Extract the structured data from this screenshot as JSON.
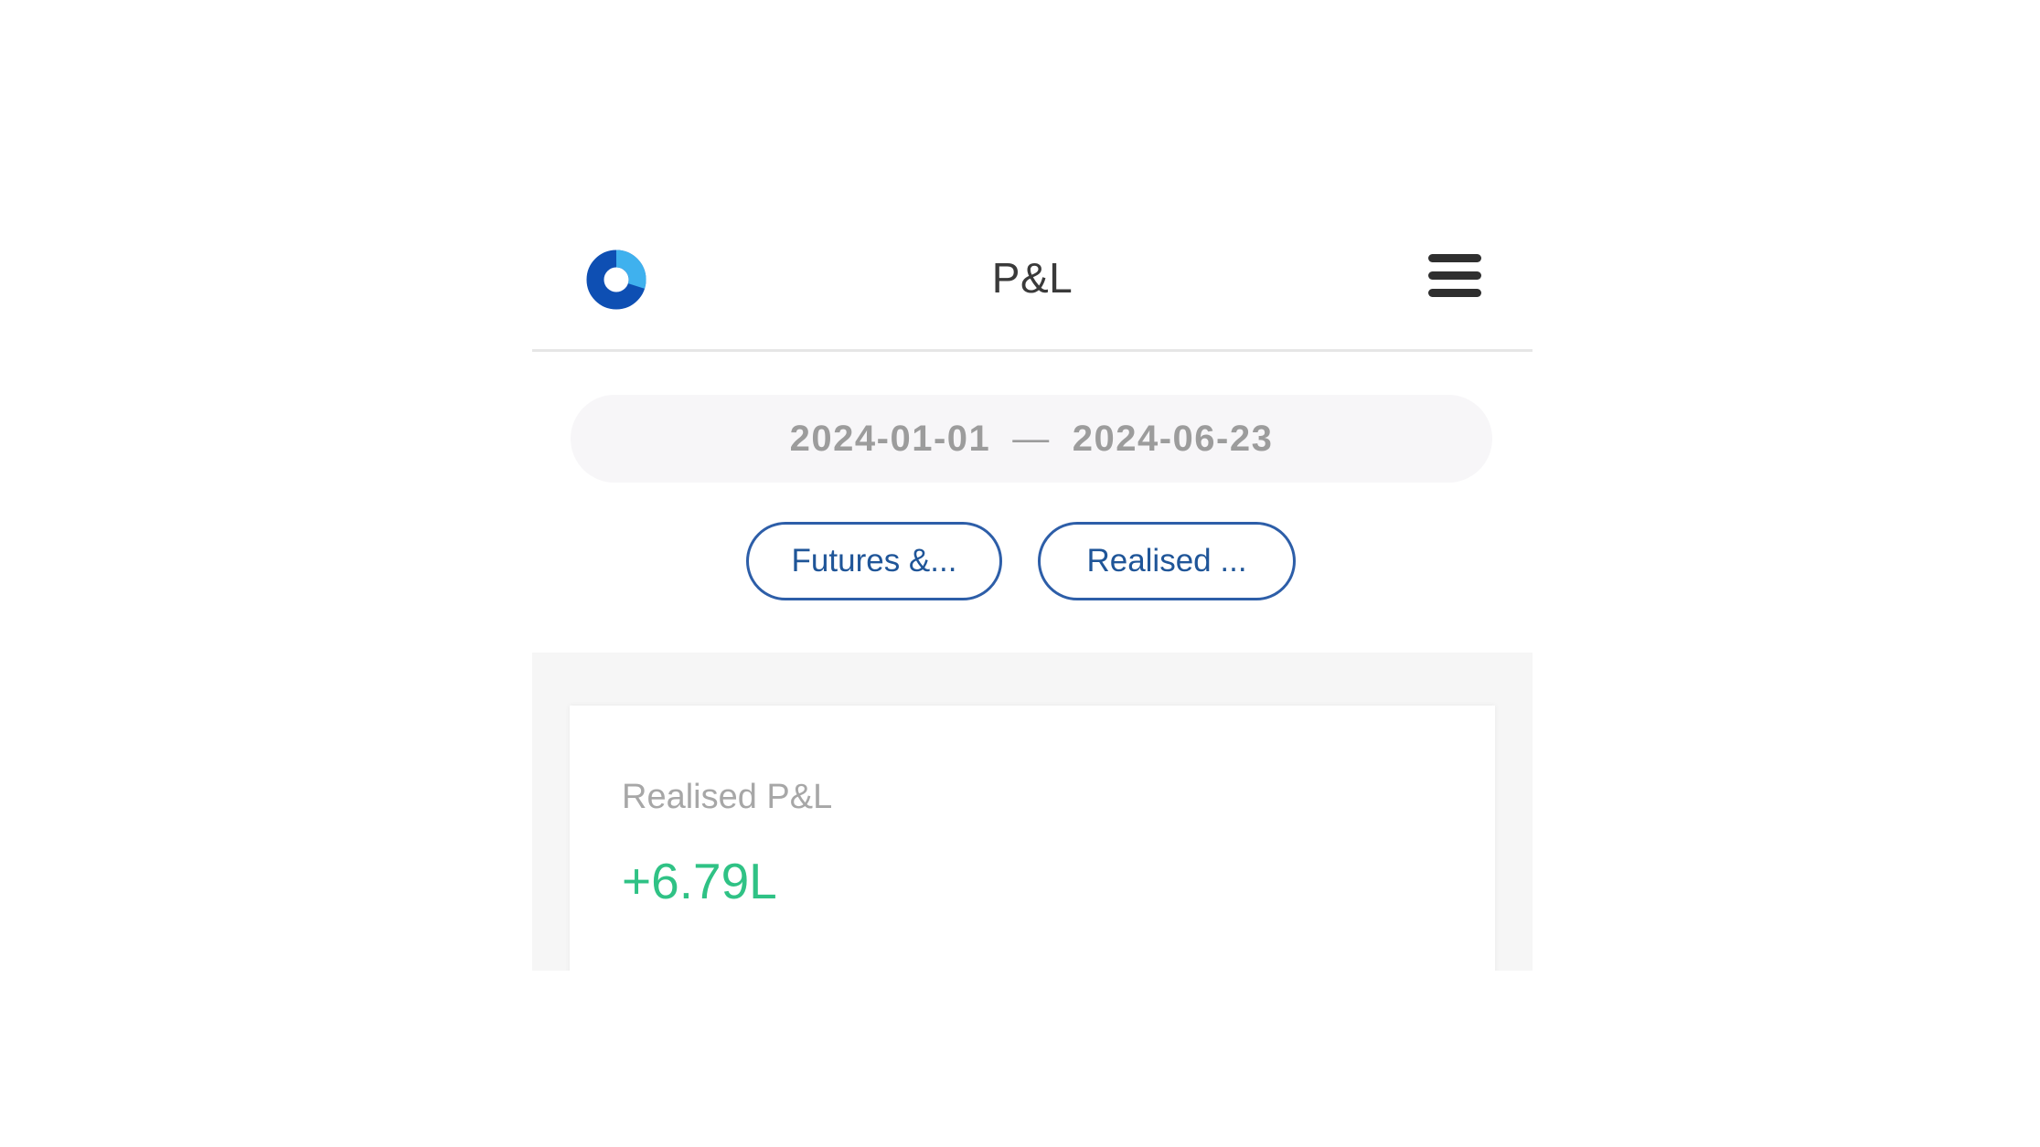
{
  "header": {
    "title": "P&L",
    "logo_icon": "console-ring-logo",
    "menu_icon": "hamburger-menu-icon"
  },
  "date_range": {
    "start": "2024-01-01",
    "separator": "—",
    "end": "2024-06-23"
  },
  "filters": {
    "segment_label": "Futures &...",
    "type_label": "Realised ..."
  },
  "summary": {
    "label": "Realised P&L",
    "value": "+6.79L"
  },
  "colors": {
    "accent_blue": "#2d5ea8",
    "logo_dark_blue": "#0e4fb3",
    "logo_light_blue": "#3fb1ee",
    "profit_green": "#2fc285"
  }
}
